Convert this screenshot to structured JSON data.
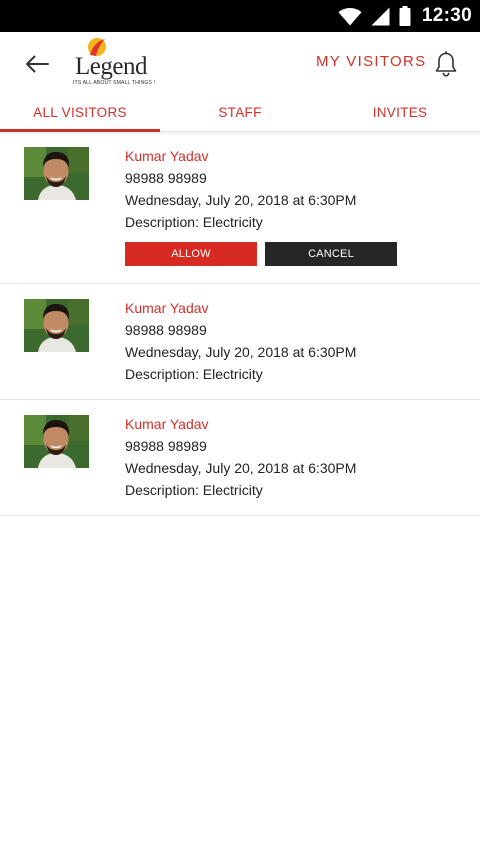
{
  "status_bar": {
    "time": "12:30",
    "icons": [
      "wifi-icon",
      "signal-icon",
      "battery-icon"
    ]
  },
  "header": {
    "logo_text": "Legend",
    "logo_tagline": "ITS ALL ABOUT SMALL THINGS !",
    "title": "MY VISITORS",
    "back_icon": "arrow-back-icon",
    "notification_icon": "bell-icon"
  },
  "tabs": [
    {
      "label": "ALL VISITORS",
      "active": true
    },
    {
      "label": "STAFF",
      "active": false
    },
    {
      "label": "INVITES",
      "active": false
    }
  ],
  "visitors": [
    {
      "name": "Kumar Yadav",
      "phone": "98988 98989",
      "datetime": "Wednesday, July 20, 2018 at 6:30PM",
      "description": "Description: Electricity",
      "actions": {
        "allow": "ALLOW",
        "cancel": "CANCEL"
      }
    },
    {
      "name": "Kumar Yadav",
      "phone": "98988 98989",
      "datetime": "Wednesday, July 20, 2018 at 6:30PM",
      "description": "Description: Electricity"
    },
    {
      "name": "Kumar Yadav",
      "phone": "98988 98989",
      "datetime": "Wednesday, July 20, 2018 at 6:30PM",
      "description": "Description: Electricity"
    }
  ],
  "colors": {
    "accent": "#d3302a",
    "allow_button": "#d62a22",
    "cancel_button": "#262626",
    "status_bar": "#000000"
  }
}
